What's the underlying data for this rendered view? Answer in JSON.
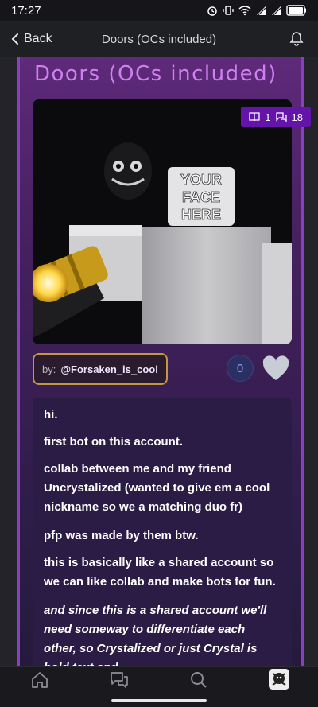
{
  "status": {
    "time": "17:27",
    "battery": "4"
  },
  "nav": {
    "back_label": "Back",
    "title": "Doors (OCs included)"
  },
  "bot": {
    "title": "Doors (OCs included)",
    "stats": {
      "chats": "1",
      "messages": "18"
    },
    "image_text": [
      "YOUR",
      "FACE",
      "HERE"
    ],
    "author_prefix": "by:",
    "author_handle": "@Forsaken_is_cool",
    "likes": "0"
  },
  "description": {
    "p1": "hi.",
    "p2": "first bot on this account.",
    "p3": "collab between me and my friend Uncrystalized (wanted to give em a cool nickname so we a matching duo fr)",
    "p4": "pfp was made by them btw.",
    "p5": "this is basically like a shared account so we can like collab and make bots for fun.",
    "p6": "and since this is a shared account we'll need someway to differentiate each other, so Crystalized or just Crystal is bold text and"
  },
  "colors": {
    "accent": "#8a3fc2",
    "title": "#d07ff0",
    "badge": "#6414a8",
    "author_border": "#c29642"
  },
  "icons": [
    "home-icon",
    "chats-icon",
    "search-icon",
    "profile-avatar"
  ]
}
